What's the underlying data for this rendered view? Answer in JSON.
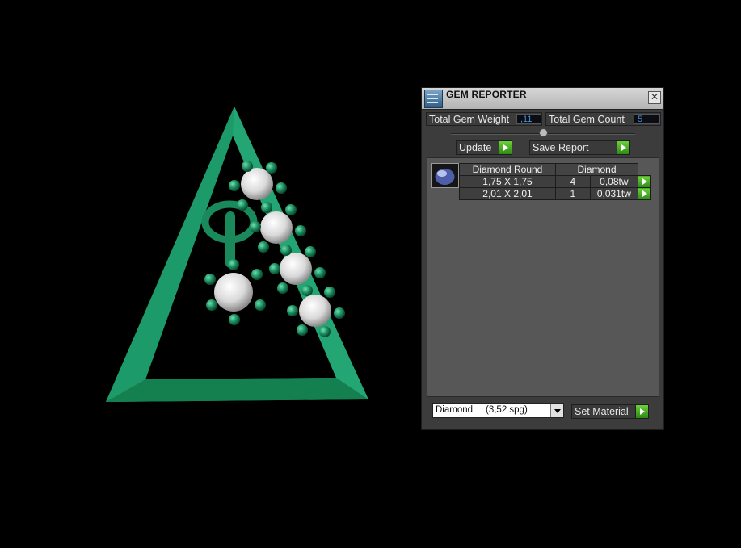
{
  "window": {
    "title": "GEM REPORTER",
    "close_label": "✕"
  },
  "stats": {
    "total_weight_label": "Total Gem Weight",
    "total_weight_value": ",11",
    "total_count_label": "Total Gem Count",
    "total_count_value": "5"
  },
  "toolbar": {
    "update_label": "Update",
    "save_report_label": "Save Report"
  },
  "gem_table": {
    "headers": [
      "Diamond Round",
      "Diamond"
    ],
    "rows": [
      {
        "size": "1,75 X 1,75",
        "count": "4",
        "weight": "0,08tw"
      },
      {
        "size": "2,01 X 2,01",
        "count": "1",
        "weight": "0,031tw"
      }
    ]
  },
  "material": {
    "selected": "Diamond     (3,52 spg)",
    "set_material_label": "Set Material"
  },
  "colors": {
    "metal_green": "#1f8f62",
    "accent_green": "#4fbf2a",
    "value_blue": "#4b8fd0"
  }
}
